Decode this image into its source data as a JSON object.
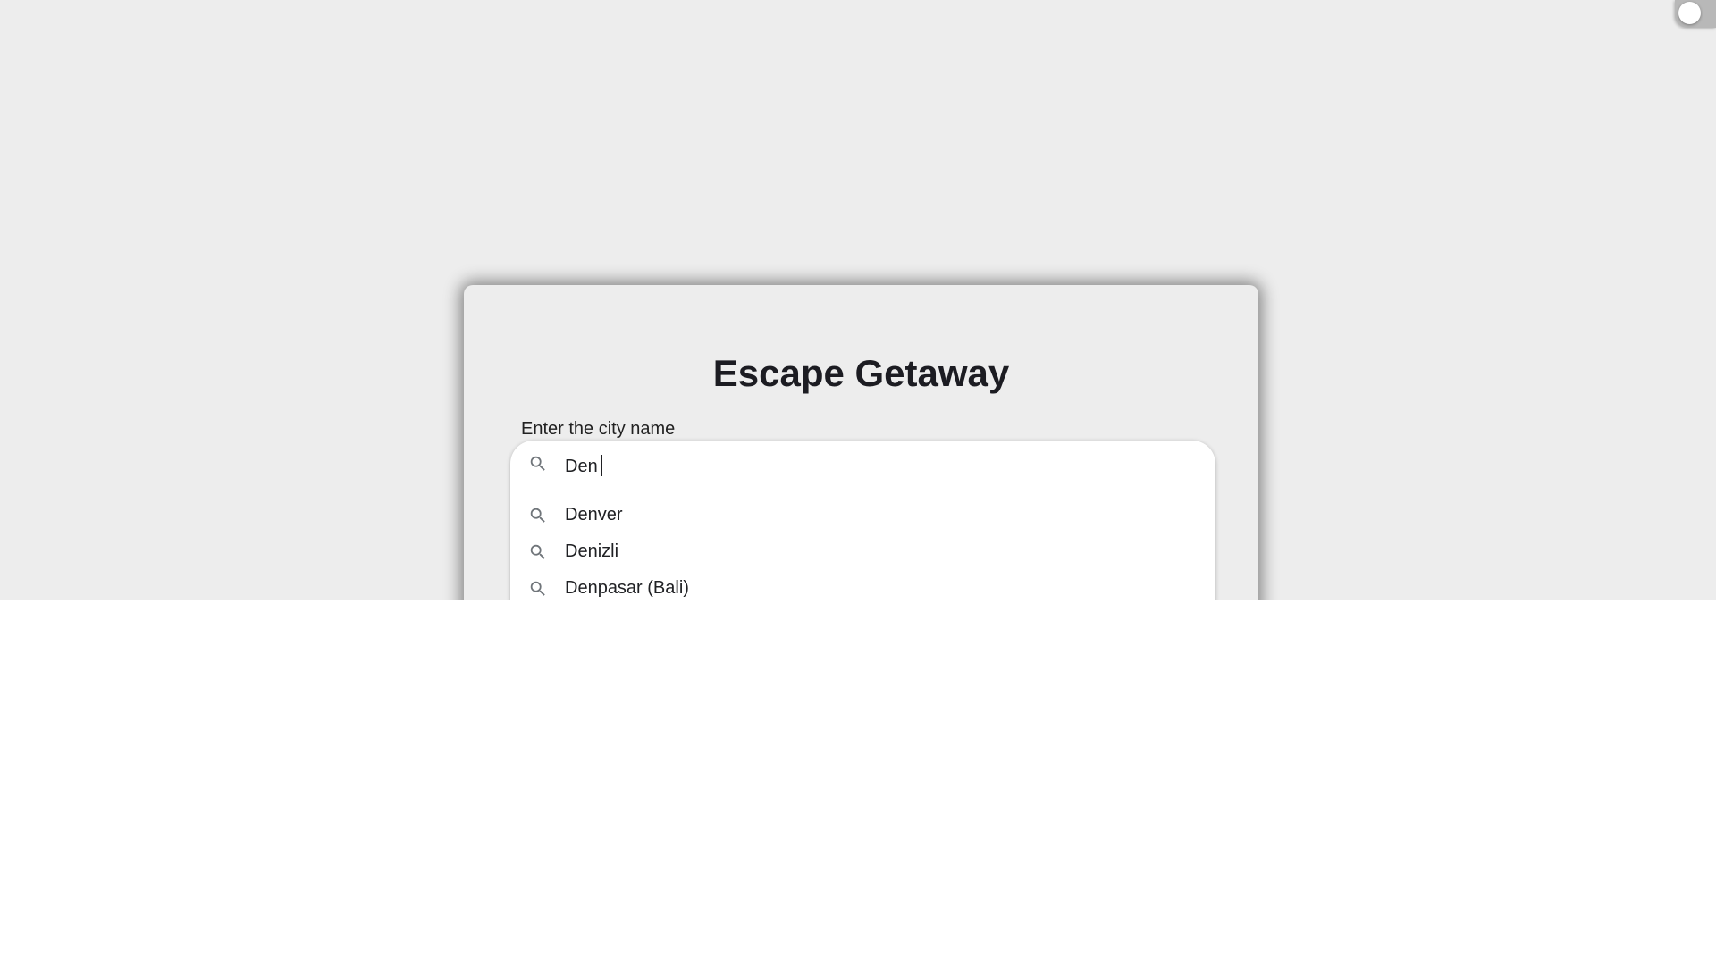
{
  "app": {
    "title": "Escape Getaway"
  },
  "form": {
    "label": "Enter the city name",
    "search_value": "Den"
  },
  "suggestions": [
    {
      "label": "Denver"
    },
    {
      "label": "Denizli"
    },
    {
      "label": "Denpasar (Bali)"
    }
  ],
  "theme_toggle": {
    "state": "off"
  },
  "colors": {
    "page_background": "#ededed",
    "card_background": "#ededed",
    "title": "#1c1c22",
    "icon": "#70757a"
  }
}
